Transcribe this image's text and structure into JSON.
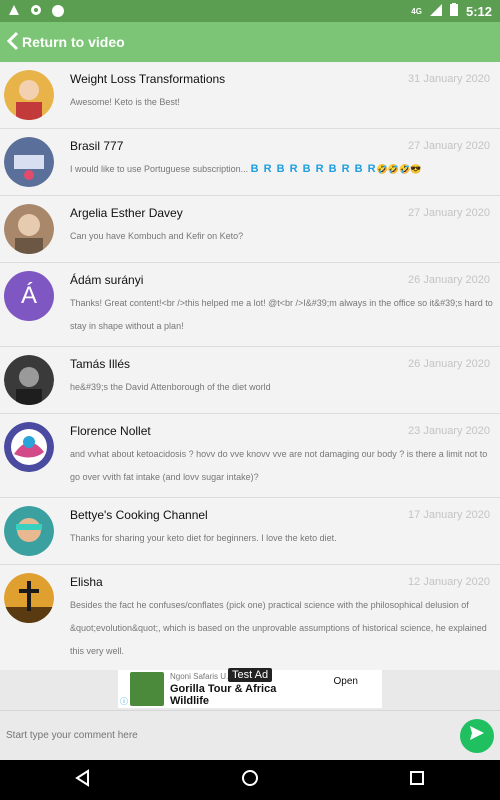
{
  "status_bar": {
    "network": "4G",
    "time": "5:12"
  },
  "header": {
    "back_label": "Return to video"
  },
  "comments": [
    {
      "name": "Weight Loss Transformations",
      "date": "31 January 2020",
      "text": "Awesome! Keto is the Best!",
      "avatar_color": "#e8b44a"
    },
    {
      "name": "Brasil 777",
      "date": "27 January 2020",
      "text": "I would like to use Portuguese subscription...",
      "accent": "B R B R B R B R B R",
      "emoji": "🤣🤣🤣😎",
      "avatar_color": "#5a6f9a"
    },
    {
      "name": "Argelia Esther Davey",
      "date": "27 January 2020",
      "text": "Can you have Kombuch and Kefir on Keto?",
      "avatar_color": "#a8876a"
    },
    {
      "name": "Ádám surányi",
      "date": "26 January 2020",
      "text": "Thanks! Great content!<br />this helped me a lot! @t<br />I&#39;m always in the office so it&#39;s hard to stay in shape without a plan!",
      "avatar_letter": "Á",
      "avatar_color": "#7e57c2"
    },
    {
      "name": "Tamás Illés",
      "date": "26 January 2020",
      "text": "he&#39;s the David Attenborough of the diet world",
      "avatar_color": "#3a3a3a"
    },
    {
      "name": "Florence Nollet",
      "date": "23 January 2020",
      "text": "and vvhat about ketoacidosis ? hovv do vve knovv vve are not damaging our body ? is there a limit not to go over vvith fat intake (and lovv sugar intake)?",
      "avatar_color": "#4a4aa0"
    },
    {
      "name": "Bettye's Cooking Channel",
      "date": "17 January 2020",
      "text": "Thanks for sharing your keto diet for beginners.  I love the keto diet.",
      "avatar_color": "#3aa0a0"
    },
    {
      "name": "Elisha",
      "date": "12 January 2020",
      "text": "Besides the fact he confuses/conflates (pick one) practical science with the philosophical delusion of &quot;evolution&quot;, which is based on the unprovable assumptions of historical science, he explained this very well.",
      "avatar_color": "#e0a030"
    }
  ],
  "ad": {
    "tag": "Test Ad",
    "source": "Ngoni Safaris U...",
    "title_line1": "Gorilla Tour & Africa",
    "title_line2": "Wildlife",
    "cta": "Open"
  },
  "compose": {
    "placeholder": "Start type your comment here"
  },
  "colors": {
    "app_bar": "#7cc576",
    "status_bar": "#5b9e52",
    "send": "#20c060",
    "accent": "#1f9fe0"
  }
}
